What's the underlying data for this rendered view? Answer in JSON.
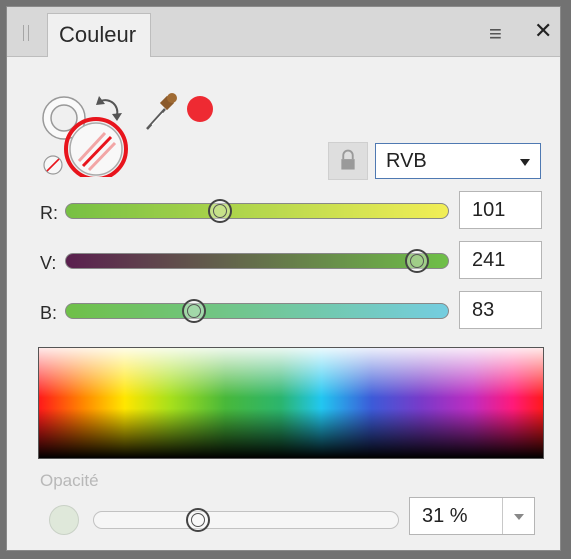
{
  "panel": {
    "tab_label": "Couleur"
  },
  "color_model": {
    "selected": "RVB"
  },
  "sliders": [
    {
      "label": "R:",
      "value": "101",
      "fraction": 0.396,
      "gradient": [
        "#77c043",
        "#f2ee56"
      ]
    },
    {
      "label": "V:",
      "value": "241",
      "fraction": 0.945,
      "gradient": [
        "#5a1f4e",
        "#6fc048"
      ]
    },
    {
      "label": "B:",
      "value": "83",
      "fraction": 0.325,
      "gradient": [
        "#6fc048",
        "#74cde0"
      ]
    }
  ],
  "current_color": "#ee2a32",
  "opacity": {
    "label": "Opacité",
    "value": "31 %",
    "fraction": 0.33
  },
  "icons": {
    "menu": "hamburger-menu-icon",
    "close": "close-icon",
    "lock": "lock-icon",
    "eyedropper": "eyedropper-icon",
    "swap": "swap-colors-icon"
  },
  "colors": {
    "highlight_ring": "#e8141c",
    "select_border": "#4f79b2"
  }
}
